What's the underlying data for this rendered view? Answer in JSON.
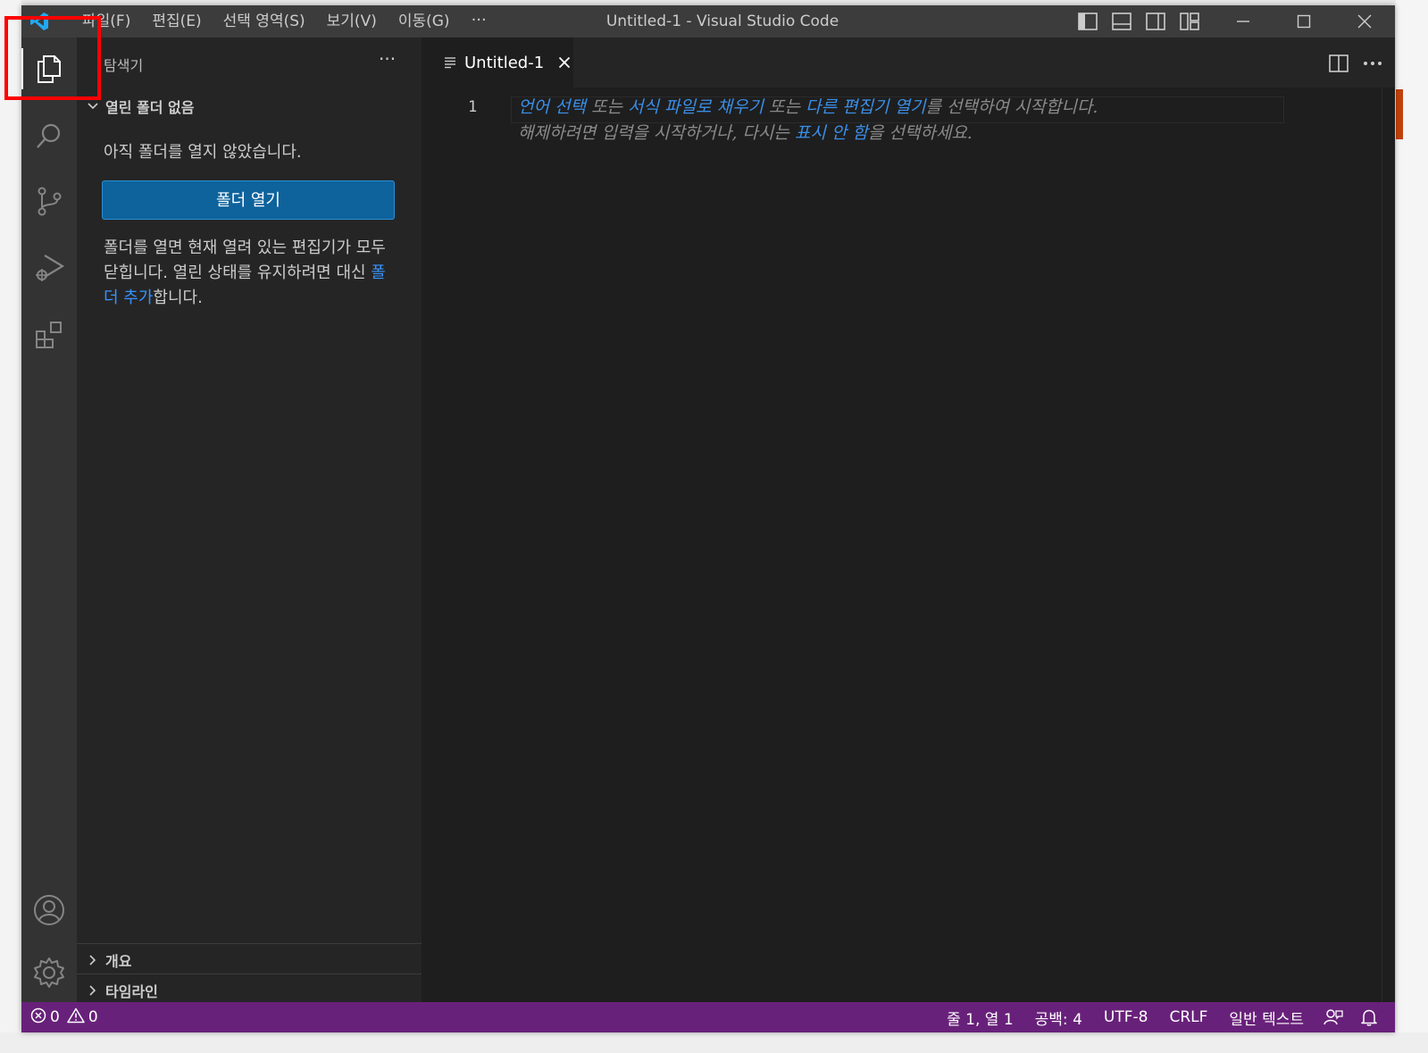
{
  "titlebar": {
    "menus": [
      "파일(F)",
      "편집(E)",
      "선택 영역(S)",
      "보기(V)",
      "이동(G)"
    ],
    "more": "···",
    "title": "Untitled-1 - Visual Studio Code"
  },
  "sidebar": {
    "title": "탐색기",
    "more": "···",
    "section_no_folder": "열린 폴더 없음",
    "message": "아직 폴더를 열지 않았습니다.",
    "open_folder_button": "폴더 열기",
    "note_prefix": "폴더를 열면 현재 열려 있는 편집기가 모두 닫힙니다. 열린 상태를 유지하려면 대신 ",
    "note_link": "폴더 추가",
    "note_suffix": "합니다.",
    "section_outline": "개요",
    "section_timeline": "타임라인"
  },
  "editor": {
    "tab_label": "Untitled-1",
    "line_number": "1",
    "hint_line1": {
      "link1": "언어 선택",
      "t1": " 또는 ",
      "link2": "서식 파일로 채우기",
      "t2": " 또는 ",
      "link3": "다른 편집기 열기",
      "t3": "를 선택하여 시작합니다."
    },
    "hint_line2": {
      "t1": "해제하려면 입력을 시작하거나, 다시는 ",
      "link": "표시 안 함",
      "t2": "을 선택하세요."
    }
  },
  "statusbar": {
    "errors": "0",
    "warnings": "0",
    "position": "줄 1, 열 1",
    "spaces": "공백: 4",
    "encoding": "UTF-8",
    "eol": "CRLF",
    "language": "일반 텍스트"
  },
  "colors": {
    "statusbar": "#68217a",
    "button": "#0e639c",
    "link": "#3794ff",
    "highlight": "#ff0000"
  }
}
